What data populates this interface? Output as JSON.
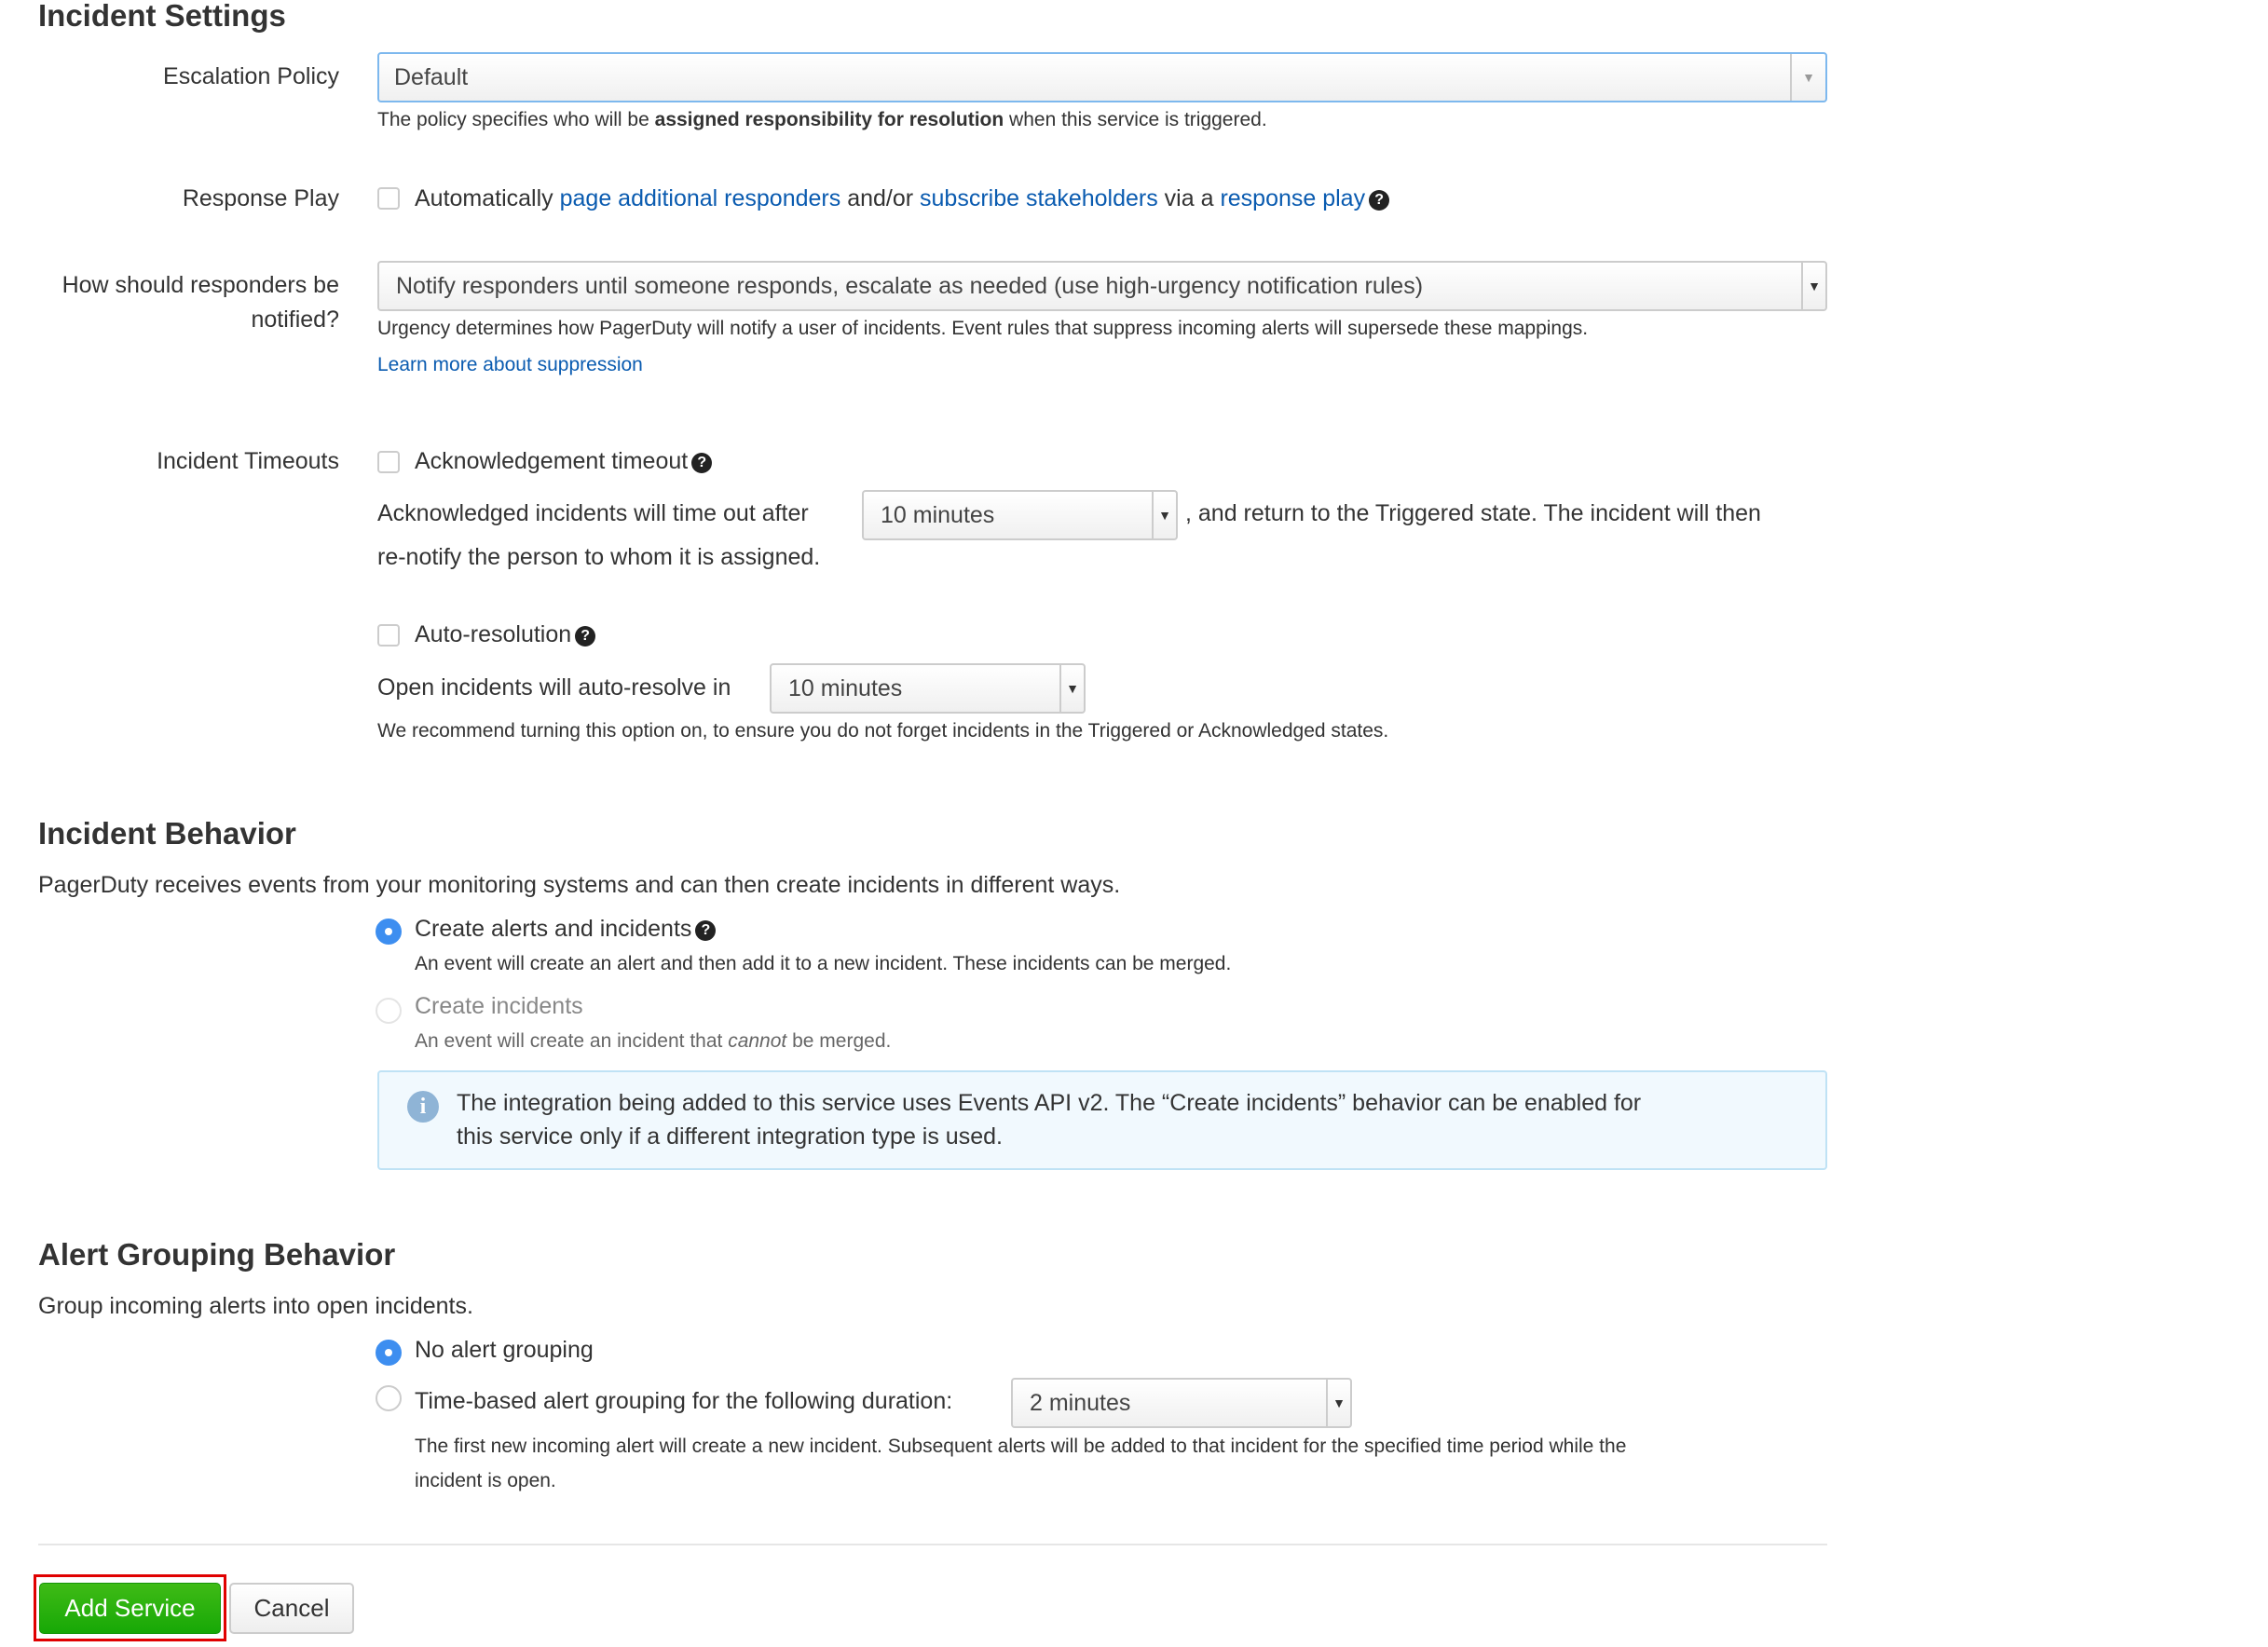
{
  "incident_settings": {
    "title": "Incident Settings",
    "escalation": {
      "label": "Escalation Policy",
      "value": "Default",
      "help_pre": "The policy specifies who will be ",
      "help_bold": "assigned responsibility for resolution",
      "help_post": " when this service is triggered."
    },
    "response_play": {
      "label": "Response Play",
      "t1": "Automatically ",
      "l1": "page additional responders",
      "t2": " and/or ",
      "l2": "subscribe stakeholders",
      "t3": " via a ",
      "l3": "response play",
      "checked": false
    },
    "notify": {
      "label1": "How should responders be",
      "label2": "notified?",
      "value": "Notify responders until someone responds, escalate as needed (use high-urgency notification rules)",
      "help": "Urgency determines how PagerDuty will notify a user of incidents. Event rules that suppress incoming alerts will supersede these mappings.",
      "link": "Learn more about suppression"
    },
    "timeouts": {
      "label": "Incident Timeouts",
      "ack_label": "Acknowledgement timeout",
      "ack_checked": false,
      "ack_pre": "Acknowledged incidents will time out after",
      "ack_value": "10 minutes",
      "ack_post": ", and return to the Triggered state. The incident will then",
      "ack_line2": "re-notify the person to whom it is assigned.",
      "auto_label": "Auto-resolution",
      "auto_checked": false,
      "auto_pre": "Open incidents will auto-resolve in",
      "auto_value": "10 minutes",
      "auto_help": "We recommend turning this option on, to ensure you do not forget incidents in the Triggered or Acknowledged states."
    }
  },
  "incident_behavior": {
    "title": "Incident Behavior",
    "desc": "PagerDuty receives events from your monitoring systems and can then create incidents in different ways.",
    "opt1": {
      "label": "Create alerts and incidents",
      "help": "An event will create an alert and then add it to a new incident. These incidents can be merged.",
      "selected": true
    },
    "opt2": {
      "label": "Create incidents",
      "help_pre": "An event will create an incident that ",
      "help_em": "cannot",
      "help_post": " be merged.",
      "selected": false,
      "disabled": true
    },
    "info1": "The integration being added to this service uses Events API v2. The “Create incidents” behavior can be enabled for",
    "info2": "this service only if a different integration type is used."
  },
  "alert_grouping": {
    "title": "Alert Grouping Behavior",
    "desc": "Group incoming alerts into open incidents.",
    "opt1": {
      "label": "No alert grouping",
      "selected": true
    },
    "opt2": {
      "label": "Time-based alert grouping for the following duration:",
      "value": "2 minutes",
      "selected": false
    },
    "help1": "The first new incoming alert will create a new incident. Subsequent alerts will be added to that incident for the specified time period while the",
    "help2": "incident is open."
  },
  "actions": {
    "add": "Add Service",
    "cancel": "Cancel"
  },
  "colors": {
    "link": "#0a5bb0",
    "radio": "#3d8ef0",
    "primary": "#1fae0c",
    "highlight": "#e00000",
    "info_bg": "#f1f9fe"
  }
}
